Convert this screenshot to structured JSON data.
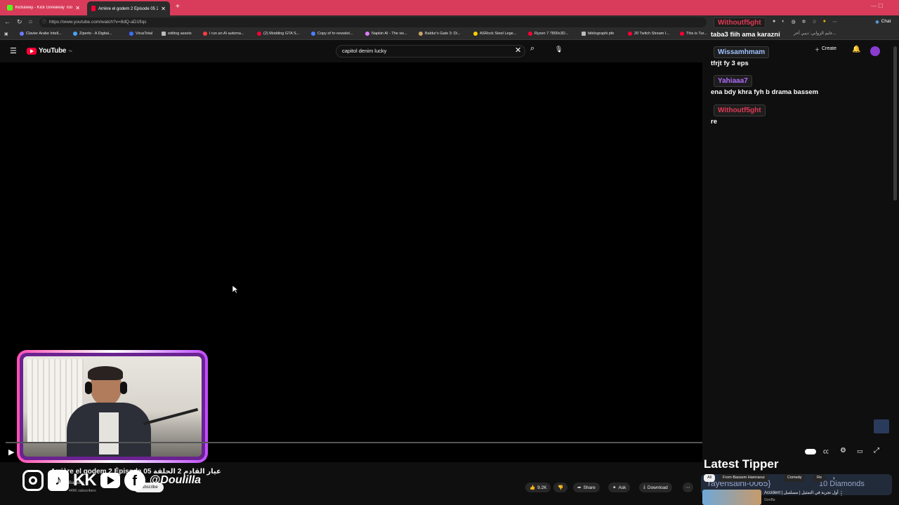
{
  "tabs": [
    {
      "title": "Kickaway - Kick Giveaway Tool",
      "active": false
    },
    {
      "title": "Arrière el godem 2 Épisode 05 عيار القادم 2",
      "active": true
    }
  ],
  "address": {
    "url": "https://www.youtube.com/watch?v=8dQ-aD1fIqs"
  },
  "bookmarks": [
    "Clavier Arabe Intell...",
    "Ziperto - A Digital...",
    "VirusTotal",
    "editing assets",
    "I run an AI automa...",
    "(2) Modding GTA S...",
    "Copy of hr-newslet...",
    "Napkin AI - The vis...",
    "Baldur's Gate 3: Di...",
    "ASRock Steel Lege...",
    "Ryzen 7 7800x3D...",
    "bibliographi pfe",
    "20 Twitch Stream I...",
    "This is Tur..."
  ],
  "youtube": {
    "logo": "YouTube",
    "logo_sup": "TN",
    "search_value": "capitol denim  lucky",
    "create_label": "Create"
  },
  "browser_chat_label": "Chat",
  "chat": [
    {
      "name": "Withoutf5ght",
      "message": "taba3 fiih ama karazni",
      "name_color": "#e03a55"
    },
    {
      "name": "Wissamhmam",
      "message": "tfrjt fy 3 eps",
      "name_color": "#9fc0ff"
    },
    {
      "name": "Yahiaaa7",
      "message": "ena bdy khra fyh b drama bassem",
      "name_color": "#b36bff"
    },
    {
      "name": "Withoutf5ght",
      "message": "re",
      "name_color": "#e03a55"
    }
  ],
  "chat_side_text": "عايم الزوابي: ديبي أحر...",
  "video": {
    "title": "Arrière el godem 2 Épisode 05 عيار القادم 2 الحلقة",
    "subscribers": "449K subscribers",
    "subscribe_label": "Subscribe",
    "channel_abbr": "Bassem H"
  },
  "social": {
    "handle": "@Doulilla",
    "icons": [
      "instagram-icon",
      "tiktok-icon",
      "kick-icon",
      "youtube-icon",
      "facebook-icon"
    ]
  },
  "actions": {
    "likes": "9.2K",
    "share": "Share",
    "ask": "Ask",
    "download": "Download"
  },
  "tipper": {
    "title": "Latest Tipper",
    "name": "rayensalhi-0065}",
    "amount": "10 Diamonds",
    "chips": [
      "All",
      "From Bassem Hamraoui",
      "Comedy",
      "Re"
    ],
    "rec_title": "Accident | أول تجربة في التمثيل | مسلسل",
    "rec_channel": "GooBa"
  }
}
